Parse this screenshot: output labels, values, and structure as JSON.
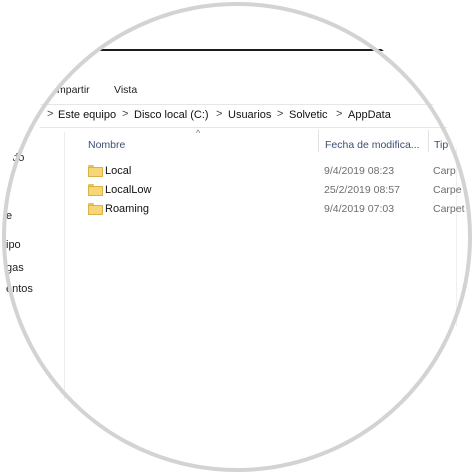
{
  "ribbon": {
    "tabs": [
      "mpartir",
      "Vista"
    ]
  },
  "address": {
    "crumbs": [
      "Este equipo",
      "Disco local (C:)",
      "Usuarios",
      "Solvetic",
      "AppData"
    ],
    "separator": ">"
  },
  "columns": {
    "name": "Nombre",
    "date": "Fecha de modifica...",
    "type": "Tip"
  },
  "files": [
    {
      "name": "Local",
      "date": "9/4/2019 08:23",
      "type": "Carp"
    },
    {
      "name": "LocalLow",
      "date": "25/2/2019 08:57",
      "type": "Carpe"
    },
    {
      "name": "Roaming",
      "date": "9/4/2019 07:03",
      "type": "Carpet"
    }
  ],
  "sidebar": {
    "items": [
      "ado",
      "e",
      "ipo",
      "gas",
      "entos"
    ]
  },
  "colors": {
    "folder": "#f6d676",
    "ring": "#d3d3d3",
    "column_header": "#3b4f74"
  }
}
